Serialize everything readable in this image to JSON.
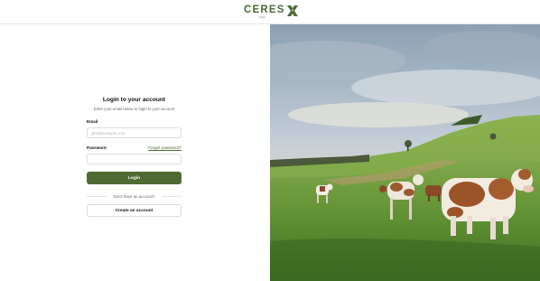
{
  "brand": {
    "name": "CERES",
    "tagline": "TAG",
    "accent_color": "#4e6b34",
    "logo_icon": "x-mark-icon"
  },
  "login": {
    "title": "Login to your account",
    "subtitle": "Enter your email below to login to your account",
    "email_label": "Email",
    "email_placeholder": "john@example.com",
    "email_value": "",
    "password_label": "Password",
    "password_value": "",
    "forgot_password_label": "Forgot password?",
    "login_button_label": "Login",
    "no_account_text": "Don't have an account?",
    "create_account_label": "Create an account"
  },
  "hero_image": {
    "subject": "cows-grazing-in-green-pasture"
  }
}
